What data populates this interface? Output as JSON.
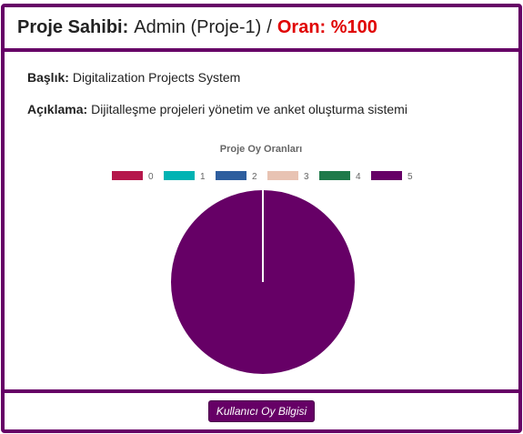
{
  "header": {
    "owner_label": "Proje Sahibi:",
    "owner_value": "Admin (Proje-1)",
    "separator": "/",
    "rate_text": "Oran: %100"
  },
  "details": {
    "title_label": "Başlık:",
    "title_value": "Digitalization Projects System",
    "desc_label": "Açıklama:",
    "desc_value": "Dijitalleşme projeleri yönetim ve anket oluşturma sistemi"
  },
  "chart_data": {
    "type": "pie",
    "title": "Proje Oy Oranları",
    "legend_position": "top",
    "categories": [
      "0",
      "1",
      "2",
      "3",
      "4",
      "5"
    ],
    "colors": [
      "#b5174b",
      "#00b3b3",
      "#2e5e9e",
      "#e8c3b3",
      "#1f7a4a",
      "#660066"
    ],
    "values": [
      0,
      0,
      0,
      0,
      0,
      100
    ]
  },
  "footer": {
    "button_label": "Kullanıcı Oy Bilgisi"
  }
}
